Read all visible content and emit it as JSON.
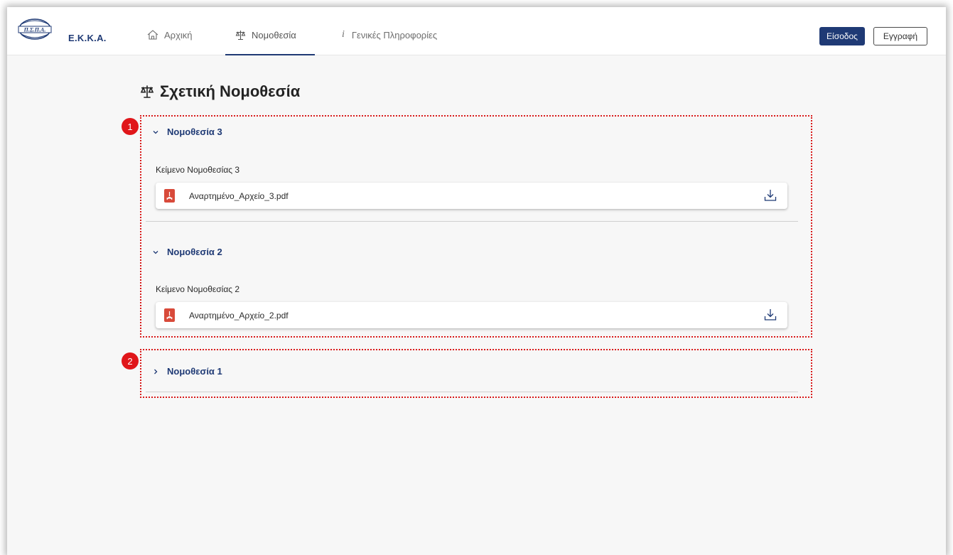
{
  "header": {
    "brand": "Ε.Κ.Κ.Α.",
    "logo_text": "Π.Σ.Π.Α.",
    "nav": [
      {
        "label": "Αρχική",
        "icon": "home-icon"
      },
      {
        "label": "Νομοθεσία",
        "icon": "scales-icon",
        "active": true
      },
      {
        "label": "Γενικές Πληροφορίες",
        "icon": "info-icon"
      }
    ],
    "login_label": "Είσοδος",
    "register_label": "Εγγραφή"
  },
  "main": {
    "title": "Σχετική Νομοθεσία",
    "legislations": [
      {
        "label": "Νομοθεσία 3",
        "expanded": true,
        "text": "Κείμενο Νομοθεσίας 3",
        "file": "Αναρτημένο_Αρχείο_3.pdf"
      },
      {
        "label": "Νομοθεσία 2",
        "expanded": true,
        "text": "Κείμενο Νομοθεσίας 2",
        "file": "Αναρτημένο_Αρχείο_2.pdf"
      },
      {
        "label": "Νομοθεσία 1",
        "expanded": false
      }
    ],
    "annotations": [
      "1",
      "2"
    ]
  },
  "colors": {
    "primary": "#1f3a75",
    "highlight": "#d91a1a",
    "badge": "#e0161a",
    "pdf": "#d84a3a"
  }
}
